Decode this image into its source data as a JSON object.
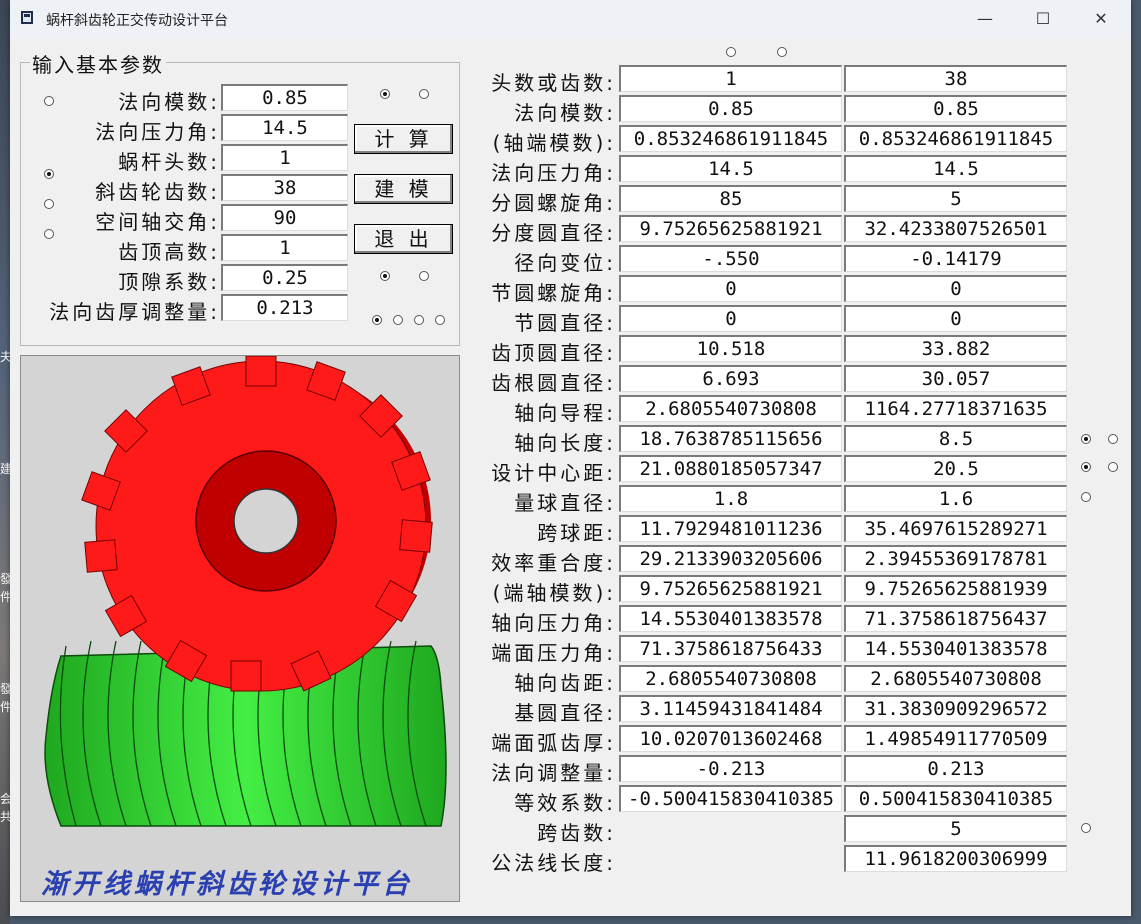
{
  "window": {
    "title": "蜗杆斜齿轮正交传动设计平台",
    "minimize_glyph": "—",
    "maximize_glyph": "☐",
    "close_glyph": "✕"
  },
  "input_group": {
    "title": "输入基本参数",
    "fields": [
      {
        "label": "法向模数:",
        "value": "0.85"
      },
      {
        "label": "法向压力角:",
        "value": "14.5"
      },
      {
        "label": "蜗杆头数:",
        "value": "1"
      },
      {
        "label": "斜齿轮齿数:",
        "value": "38"
      },
      {
        "label": "空间轴交角:",
        "value": "90"
      },
      {
        "label": "齿顶高数:",
        "value": "1"
      },
      {
        "label": "顶隙系数:",
        "value": "0.25"
      },
      {
        "label": "法向齿厚调整量:",
        "value": "0.213"
      }
    ],
    "buttons": {
      "calc": "计 算",
      "model": "建 模",
      "exit": "退 出"
    }
  },
  "picture": {
    "caption": "渐开线蜗杆斜齿轮设计平台"
  },
  "results": [
    {
      "label": "头数或齿数:",
      "worm": "1",
      "gear": "38"
    },
    {
      "label": "法向模数:",
      "worm": "0.85",
      "gear": "0.85"
    },
    {
      "label": "(轴端模数):",
      "worm": "0.853246861911845",
      "gear": "0.853246861911845"
    },
    {
      "label": "法向压力角:",
      "worm": "14.5",
      "gear": "14.5"
    },
    {
      "label": "分圆螺旋角:",
      "worm": "85",
      "gear": "5"
    },
    {
      "label": "分度圆直径:",
      "worm": "9.75265625881921",
      "gear": "32.4233807526501"
    },
    {
      "label": "径向变位:",
      "worm": "-.550",
      "gear": "-0.14179"
    },
    {
      "label": "节圆螺旋角:",
      "worm": "0",
      "gear": "0"
    },
    {
      "label": "节圆直径:",
      "worm": "0",
      "gear": "0"
    },
    {
      "label": "齿顶圆直径:",
      "worm": "10.518",
      "gear": "33.882"
    },
    {
      "label": "齿根圆直径:",
      "worm": "6.693",
      "gear": "30.057"
    },
    {
      "label": "轴向导程:",
      "worm": "2.6805540730808",
      "gear": "1164.27718371635"
    },
    {
      "label": "轴向长度:",
      "worm": "18.7638785115656",
      "gear": "8.5"
    },
    {
      "label": "设计中心距:",
      "worm": "21.0880185057347",
      "gear": "20.5"
    },
    {
      "label": "量球直径:",
      "worm": "1.8",
      "gear": "1.6"
    },
    {
      "label": "跨球距:",
      "worm": "11.7929481011236",
      "gear": "35.4697615289271"
    },
    {
      "label": "效率重合度:",
      "worm": "29.2133903205606",
      "gear": "2.39455369178781"
    },
    {
      "label": "(端轴模数):",
      "worm": "9.75265625881921",
      "gear": "9.75265625881939"
    },
    {
      "label": "轴向压力角:",
      "worm": "14.5530401383578",
      "gear": "71.3758618756437"
    },
    {
      "label": "端面压力角:",
      "worm": "71.3758618756433",
      "gear": "14.5530401383578"
    },
    {
      "label": "轴向齿距:",
      "worm": "2.6805540730808",
      "gear": "2.6805540730808"
    },
    {
      "label": "基圆直径:",
      "worm": "3.11459431841484",
      "gear": "31.3830909296572"
    },
    {
      "label": "端面弧齿厚:",
      "worm": "10.0207013602468",
      "gear": "1.49854911770509"
    },
    {
      "label": "法向调整量:",
      "worm": "-0.213",
      "gear": "0.213"
    },
    {
      "label": "等效系数:",
      "worm": "-0.500415830410385",
      "gear": "0.500415830410385"
    },
    {
      "label": "跨齿数:",
      "worm": null,
      "gear": "5"
    },
    {
      "label": "公法线长度:",
      "worm": null,
      "gear": "11.9618200306999"
    }
  ],
  "colors": {
    "gear": "#ff1a1a",
    "worm": "#33dd33",
    "caption": "#2a3fb0"
  },
  "desktop_fragments": [
    "夫",
    "建",
    "發",
    "件",
    "發",
    "件",
    "会",
    "共"
  ]
}
